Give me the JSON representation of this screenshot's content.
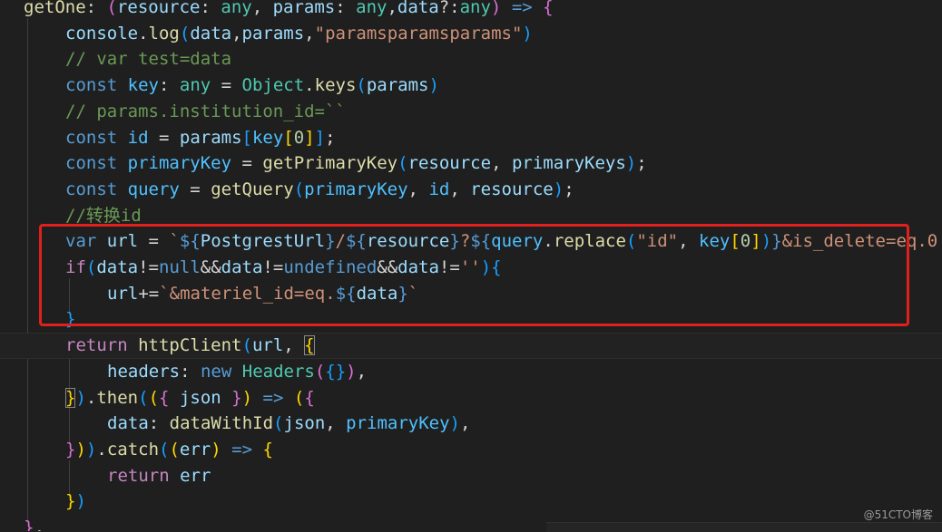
{
  "editor": {
    "language": "typescript",
    "theme": "dark",
    "lines": [
      {
        "tokens": [
          {
            "t": "getOne",
            "c": "fn"
          },
          {
            "t": ": ",
            "c": "txt"
          },
          {
            "t": "(",
            "c": "b2"
          },
          {
            "t": "resource",
            "c": "var"
          },
          {
            "t": ": ",
            "c": "txt"
          },
          {
            "t": "any",
            "c": "typ"
          },
          {
            "t": ", ",
            "c": "txt"
          },
          {
            "t": "params",
            "c": "var"
          },
          {
            "t": ": ",
            "c": "txt"
          },
          {
            "t": "any",
            "c": "typ"
          },
          {
            "t": ",",
            "c": "txt"
          },
          {
            "t": "data",
            "c": "var"
          },
          {
            "t": "?:",
            "c": "txt"
          },
          {
            "t": "any",
            "c": "typ"
          },
          {
            "t": ")",
            "c": "b2"
          },
          {
            "t": " ",
            "c": "txt"
          },
          {
            "t": "=>",
            "c": "kw"
          },
          {
            "t": " ",
            "c": "txt"
          },
          {
            "t": "{",
            "c": "b2"
          }
        ]
      },
      {
        "tokens": [
          {
            "t": "console",
            "c": "var"
          },
          {
            "t": ".",
            "c": "txt"
          },
          {
            "t": "log",
            "c": "fn"
          },
          {
            "t": "(",
            "c": "b3"
          },
          {
            "t": "data",
            "c": "var"
          },
          {
            "t": ",",
            "c": "txt"
          },
          {
            "t": "params",
            "c": "var"
          },
          {
            "t": ",",
            "c": "txt"
          },
          {
            "t": "\"paramsparamsparams\"",
            "c": "str"
          },
          {
            "t": ")",
            "c": "b3"
          }
        ]
      },
      {
        "tokens": [
          {
            "t": "// var test=data",
            "c": "cmt"
          }
        ]
      },
      {
        "tokens": [
          {
            "t": "const",
            "c": "kw"
          },
          {
            "t": " ",
            "c": "txt"
          },
          {
            "t": "key",
            "c": "cst"
          },
          {
            "t": ": ",
            "c": "txt"
          },
          {
            "t": "any",
            "c": "typ"
          },
          {
            "t": " = ",
            "c": "txt"
          },
          {
            "t": "Object",
            "c": "typ"
          },
          {
            "t": ".",
            "c": "txt"
          },
          {
            "t": "keys",
            "c": "fn"
          },
          {
            "t": "(",
            "c": "b3"
          },
          {
            "t": "params",
            "c": "var"
          },
          {
            "t": ")",
            "c": "b3"
          }
        ]
      },
      {
        "tokens": [
          {
            "t": "// params.institution_id=``",
            "c": "cmt"
          }
        ]
      },
      {
        "tokens": [
          {
            "t": "const",
            "c": "kw"
          },
          {
            "t": " ",
            "c": "txt"
          },
          {
            "t": "id",
            "c": "cst"
          },
          {
            "t": " = ",
            "c": "txt"
          },
          {
            "t": "params",
            "c": "var"
          },
          {
            "t": "[",
            "c": "b3"
          },
          {
            "t": "key",
            "c": "cst"
          },
          {
            "t": "[",
            "c": "b1"
          },
          {
            "t": "0",
            "c": "num"
          },
          {
            "t": "]",
            "c": "b1"
          },
          {
            "t": "]",
            "c": "b3"
          },
          {
            "t": ";",
            "c": "txt"
          }
        ]
      },
      {
        "tokens": [
          {
            "t": "const",
            "c": "kw"
          },
          {
            "t": " ",
            "c": "txt"
          },
          {
            "t": "primaryKey",
            "c": "cst"
          },
          {
            "t": " = ",
            "c": "txt"
          },
          {
            "t": "getPrimaryKey",
            "c": "fn"
          },
          {
            "t": "(",
            "c": "b3"
          },
          {
            "t": "resource",
            "c": "var"
          },
          {
            "t": ", ",
            "c": "txt"
          },
          {
            "t": "primaryKeys",
            "c": "var"
          },
          {
            "t": ")",
            "c": "b3"
          },
          {
            "t": ";",
            "c": "txt"
          }
        ]
      },
      {
        "tokens": [
          {
            "t": "const",
            "c": "kw"
          },
          {
            "t": " ",
            "c": "txt"
          },
          {
            "t": "query",
            "c": "cst"
          },
          {
            "t": " = ",
            "c": "txt"
          },
          {
            "t": "getQuery",
            "c": "fn"
          },
          {
            "t": "(",
            "c": "b3"
          },
          {
            "t": "primaryKey",
            "c": "cst"
          },
          {
            "t": ", ",
            "c": "txt"
          },
          {
            "t": "id",
            "c": "cst"
          },
          {
            "t": ", ",
            "c": "txt"
          },
          {
            "t": "resource",
            "c": "var"
          },
          {
            "t": ")",
            "c": "b3"
          },
          {
            "t": ";",
            "c": "txt"
          }
        ]
      },
      {
        "tokens": [
          {
            "t": "//转换id",
            "c": "cmt"
          }
        ]
      },
      {
        "tokens": [
          {
            "t": "var",
            "c": "kw"
          },
          {
            "t": " ",
            "c": "txt"
          },
          {
            "t": "url",
            "c": "var"
          },
          {
            "t": " = ",
            "c": "txt"
          },
          {
            "t": "`",
            "c": "str"
          },
          {
            "t": "${",
            "c": "tpl"
          },
          {
            "t": "PostgrestUrl",
            "c": "var"
          },
          {
            "t": "}",
            "c": "tpl"
          },
          {
            "t": "/",
            "c": "str"
          },
          {
            "t": "${",
            "c": "tpl"
          },
          {
            "t": "resource",
            "c": "var"
          },
          {
            "t": "}",
            "c": "tpl"
          },
          {
            "t": "?",
            "c": "str"
          },
          {
            "t": "${",
            "c": "tpl"
          },
          {
            "t": "query",
            "c": "cst"
          },
          {
            "t": ".",
            "c": "txt"
          },
          {
            "t": "replace",
            "c": "fn"
          },
          {
            "t": "(",
            "c": "b3"
          },
          {
            "t": "\"id\"",
            "c": "str"
          },
          {
            "t": ", ",
            "c": "txt"
          },
          {
            "t": "key",
            "c": "cst"
          },
          {
            "t": "[",
            "c": "b1"
          },
          {
            "t": "0",
            "c": "num"
          },
          {
            "t": "]",
            "c": "b1"
          },
          {
            "t": ")",
            "c": "b3"
          },
          {
            "t": "}",
            "c": "tpl"
          },
          {
            "t": "&is_delete=eq.0",
            "c": "str"
          }
        ]
      },
      {
        "tokens": [
          {
            "t": "if",
            "c": "ctl"
          },
          {
            "t": "(",
            "c": "b3"
          },
          {
            "t": "data",
            "c": "var"
          },
          {
            "t": "!=",
            "c": "txt"
          },
          {
            "t": "null",
            "c": "kw"
          },
          {
            "t": "&&",
            "c": "txt"
          },
          {
            "t": "data",
            "c": "var"
          },
          {
            "t": "!=",
            "c": "txt"
          },
          {
            "t": "undefined",
            "c": "kw"
          },
          {
            "t": "&&",
            "c": "txt"
          },
          {
            "t": "data",
            "c": "var"
          },
          {
            "t": "!=",
            "c": "txt"
          },
          {
            "t": "''",
            "c": "str"
          },
          {
            "t": ")",
            "c": "b3"
          },
          {
            "t": "{",
            "c": "b3"
          }
        ]
      },
      {
        "tokens": [
          {
            "t": "url",
            "c": "var"
          },
          {
            "t": "+=",
            "c": "txt"
          },
          {
            "t": "`&materiel_id=eq.",
            "c": "str"
          },
          {
            "t": "${",
            "c": "tpl"
          },
          {
            "t": "data",
            "c": "var"
          },
          {
            "t": "}",
            "c": "tpl"
          },
          {
            "t": "`",
            "c": "str"
          }
        ]
      },
      {
        "tokens": [
          {
            "t": "}",
            "c": "b3"
          }
        ]
      },
      {
        "tokens": [
          {
            "t": "return",
            "c": "ctl"
          },
          {
            "t": " ",
            "c": "txt"
          },
          {
            "t": "httpClient",
            "c": "fn"
          },
          {
            "t": "(",
            "c": "b3"
          },
          {
            "t": "url",
            "c": "var"
          },
          {
            "t": ", ",
            "c": "txt"
          },
          {
            "t": "{",
            "c": "b1",
            "bm": true
          }
        ]
      },
      {
        "tokens": [
          {
            "t": "headers",
            "c": "var"
          },
          {
            "t": ": ",
            "c": "txt"
          },
          {
            "t": "new",
            "c": "kw"
          },
          {
            "t": " ",
            "c": "txt"
          },
          {
            "t": "Headers",
            "c": "typ"
          },
          {
            "t": "(",
            "c": "b2"
          },
          {
            "t": "{}",
            "c": "b3"
          },
          {
            "t": ")",
            "c": "b2"
          },
          {
            "t": ",",
            "c": "txt"
          }
        ]
      },
      {
        "tokens": [
          {
            "t": "}",
            "c": "b1",
            "bm": true
          },
          {
            "t": ")",
            "c": "b3"
          },
          {
            "t": ".",
            "c": "txt"
          },
          {
            "t": "then",
            "c": "fn"
          },
          {
            "t": "(",
            "c": "b3"
          },
          {
            "t": "(",
            "c": "b1"
          },
          {
            "t": "{",
            "c": "b2"
          },
          {
            "t": " ",
            "c": "txt"
          },
          {
            "t": "json",
            "c": "var"
          },
          {
            "t": " ",
            "c": "txt"
          },
          {
            "t": "}",
            "c": "b2"
          },
          {
            "t": ")",
            "c": "b1"
          },
          {
            "t": " ",
            "c": "txt"
          },
          {
            "t": "=>",
            "c": "kw"
          },
          {
            "t": " ",
            "c": "txt"
          },
          {
            "t": "(",
            "c": "b1"
          },
          {
            "t": "{",
            "c": "b2"
          }
        ]
      },
      {
        "tokens": [
          {
            "t": "data",
            "c": "var"
          },
          {
            "t": ": ",
            "c": "txt"
          },
          {
            "t": "dataWithId",
            "c": "fn"
          },
          {
            "t": "(",
            "c": "b3"
          },
          {
            "t": "json",
            "c": "var"
          },
          {
            "t": ", ",
            "c": "txt"
          },
          {
            "t": "primaryKey",
            "c": "cst"
          },
          {
            "t": ")",
            "c": "b3"
          },
          {
            "t": ",",
            "c": "txt"
          }
        ]
      },
      {
        "tokens": [
          {
            "t": "}",
            "c": "b2"
          },
          {
            "t": ")",
            "c": "b1"
          },
          {
            "t": ")",
            "c": "b3"
          },
          {
            "t": ".",
            "c": "txt"
          },
          {
            "t": "catch",
            "c": "fn"
          },
          {
            "t": "(",
            "c": "b3"
          },
          {
            "t": "(",
            "c": "b1"
          },
          {
            "t": "err",
            "c": "var"
          },
          {
            "t": ")",
            "c": "b1"
          },
          {
            "t": " ",
            "c": "txt"
          },
          {
            "t": "=>",
            "c": "kw"
          },
          {
            "t": " ",
            "c": "txt"
          },
          {
            "t": "{",
            "c": "b1"
          }
        ]
      },
      {
        "tokens": [
          {
            "t": "return",
            "c": "ctl"
          },
          {
            "t": " ",
            "c": "txt"
          },
          {
            "t": "err",
            "c": "var"
          }
        ]
      },
      {
        "tokens": [
          {
            "t": "}",
            "c": "b1"
          },
          {
            "t": ")",
            "c": "b3"
          }
        ]
      },
      {
        "tokens": [
          {
            "t": "}",
            "c": "b2"
          },
          {
            "t": ",",
            "c": "txt"
          }
        ]
      }
    ]
  },
  "watermark": "@51CTO博客"
}
